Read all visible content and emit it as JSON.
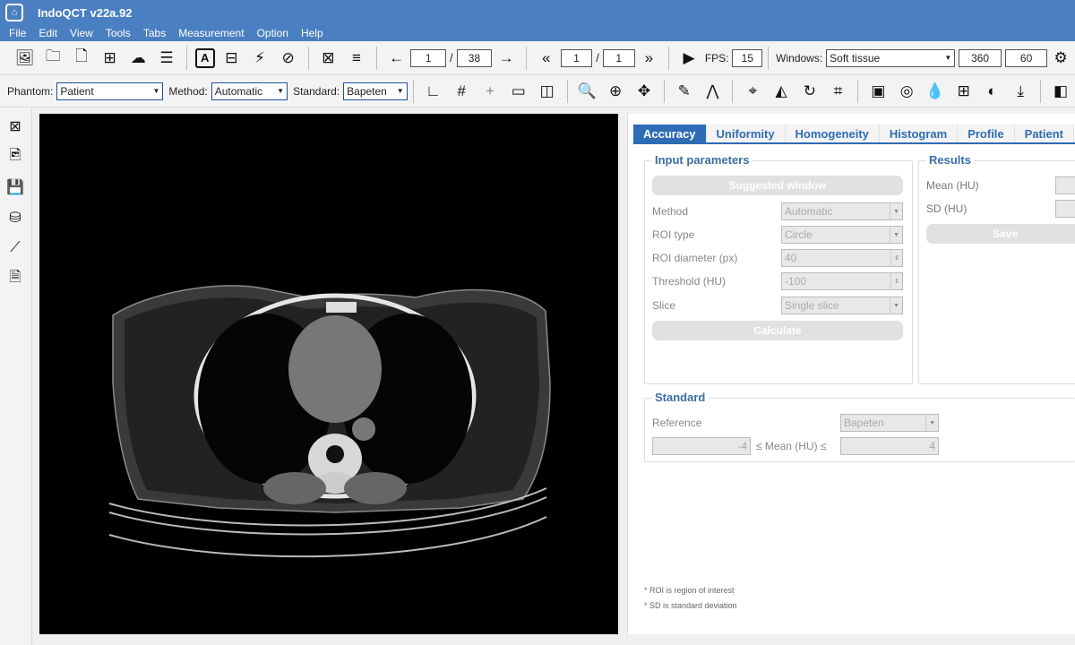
{
  "app": {
    "title": "IndoQCT v22a.92",
    "icon": "home-icon"
  },
  "menu": [
    "File",
    "Edit",
    "View",
    "Tools",
    "Tabs",
    "Measurement",
    "Option",
    "Help"
  ],
  "toolbar1": {
    "slice_current": "1",
    "slice_total": "38",
    "frame_current": "1",
    "frame_total": "1",
    "fps_label": "FPS:",
    "fps_value": "15",
    "windows_label": "Windows:",
    "windows_preset": "Soft tissue",
    "window_width": "360",
    "window_level": "60"
  },
  "toolbar2": {
    "phantom_label": "Phantom:",
    "phantom_value": "Patient",
    "method_label": "Method:",
    "method_value": "Automatic",
    "standard_label": "Standard:",
    "standard_value": "Bapeten"
  },
  "tabs": [
    "Accuracy",
    "Uniformity",
    "Homogeneity",
    "Histogram",
    "Profile",
    "Patient"
  ],
  "input_parameters": {
    "title": "Input parameters",
    "suggested_window": "Suggested window",
    "method_label": "Method",
    "method_value": "Automatic",
    "roi_type_label": "ROI type",
    "roi_type_value": "Circle",
    "roi_diameter_label": "ROI diameter (px)",
    "roi_diameter_value": "40",
    "threshold_label": "Threshold (HU)",
    "threshold_value": "-100",
    "slice_label": "Slice",
    "slice_value": "Single slice",
    "calculate": "Calculate"
  },
  "results": {
    "title": "Results",
    "mean_label": "Mean (HU)",
    "sd_label": "SD (HU)",
    "save": "Save"
  },
  "standard": {
    "title": "Standard",
    "reference_label": "Reference",
    "reference_value": "Bapeten",
    "lower": "-4",
    "range_label": "≤ Mean (HU) ≤",
    "upper": "4"
  },
  "notes": [
    "* ROI is region of interest",
    "* SD is standard deviation"
  ]
}
